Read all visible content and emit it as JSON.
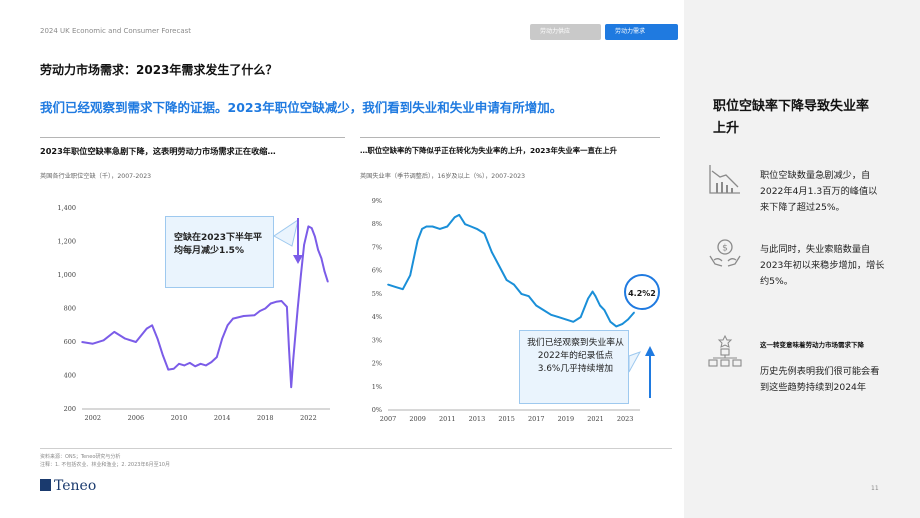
{
  "header": {
    "doc_title": "2024 UK Economic and Consumer Forecast",
    "tabs": [
      {
        "label": "劳动力供应",
        "active": false
      },
      {
        "label": "劳动力需求",
        "active": true
      }
    ]
  },
  "page": {
    "title": "劳动力市场需求：2023年需求发生了什么？",
    "subtitle": "我们已经观察到需求下降的证据。2023年职位空缺减少，我们看到失业和失业申请有所增加。"
  },
  "chart1": {
    "title": "2023年职位空缺率急剧下降，这表明劳动力市场需求正在收缩…",
    "subtitle": "英国各行业职位空缺（千），2007-2023",
    "callout": "空缺在2023下半年平均每月减少1.5%"
  },
  "chart2": {
    "title": "…职位空缺率的下降似乎正在转化为失业率的上升，2023年失业率一直在上升",
    "subtitle": "英国失业率（季节调整后），16岁及以上（%），2007-2023",
    "callout": "我们已经观察到失业率从2022年的纪录低点3.6%几乎持续增加",
    "bubble": "4.2%2"
  },
  "footer": {
    "source": "资料来源：ONS；Teneo研究与分析",
    "notes": "注释：1. 不包括农业、林业和渔业；2. 2023年6月至10月",
    "logo": "Teneo",
    "page_number": "11"
  },
  "sidebar": {
    "title": "职位空缺率下降导致失业率上升",
    "items": [
      {
        "icon": "declining-chart-icon",
        "text": "职位空缺数量急剧减少，自2022年4月1.3百万的峰值以来下降了超过25%。"
      },
      {
        "icon": "hands-money-icon",
        "text": "与此同时，失业索赔数量自2023年初以来稳步增加，增长约5%。"
      },
      {
        "icon": "org-chart-icon",
        "heading": "这一转变意味着劳动力市场需求下降",
        "text": "历史先例表明我们很可能会看到这些趋势持续到2024年"
      }
    ]
  },
  "colors": {
    "accent": "#1f7ae0",
    "line1": "#7b5ce8",
    "line2": "#1a8fd8",
    "sidebar_bg": "#f2f2f2"
  },
  "chart_data": [
    {
      "type": "line",
      "title": "2023年职位空缺率急剧下降，这表明劳动力市场需求正在收缩…",
      "ylim": [
        200,
        1400
      ],
      "yticks": [
        "200",
        "400",
        "600",
        "800",
        "1,000",
        "1,200",
        "1,400"
      ],
      "xticks": [
        "2002",
        "2006",
        "2010",
        "2014",
        "2018",
        "2022"
      ],
      "x": [
        2001.0,
        2002.0,
        2003.0,
        2004.0,
        2005.0,
        2006.0,
        2007.0,
        2007.5,
        2008.0,
        2008.5,
        2009.0,
        2009.5,
        2010.0,
        2010.5,
        2011.0,
        2011.5,
        2012.0,
        2012.5,
        2013.0,
        2013.5,
        2014.0,
        2014.5,
        2015.0,
        2016.0,
        2017.0,
        2017.5,
        2018.0,
        2018.5,
        2019.0,
        2019.5,
        2020.0,
        2020.2,
        2020.4,
        2020.6,
        2020.8,
        2021.0,
        2021.3,
        2021.6,
        2022.0,
        2022.3,
        2022.6,
        2022.9,
        2023.2,
        2023.5,
        2023.8
      ],
      "series": [
        {
          "values": [
            600,
            590,
            610,
            660,
            620,
            600,
            680,
            700,
            620,
            520,
            435,
            440,
            470,
            460,
            475,
            455,
            470,
            460,
            480,
            510,
            620,
            700,
            740,
            755,
            760,
            785,
            800,
            830,
            840,
            845,
            810,
            560,
            330,
            500,
            650,
            800,
            1000,
            1180,
            1290,
            1280,
            1230,
            1150,
            1100,
            1020,
            960
          ]
        }
      ]
    },
    {
      "type": "line",
      "title": "…职位空缺率的下降似乎正在转化为失业率的上升，2023年失业率一直在上升",
      "ylim": [
        0,
        9
      ],
      "yticks": [
        "0%",
        "1%",
        "2%",
        "3%",
        "4%",
        "5%",
        "6%",
        "7%",
        "8%",
        "9%"
      ],
      "xticks": [
        "2007",
        "2009",
        "2011",
        "2013",
        "2015",
        "2017",
        "2019",
        "2021",
        "2023"
      ],
      "x": [
        2007.0,
        2007.5,
        2008.0,
        2008.5,
        2009.0,
        2009.3,
        2009.6,
        2010.0,
        2010.5,
        2011.0,
        2011.5,
        2011.8,
        2012.2,
        2012.6,
        2013.0,
        2013.5,
        2014.0,
        2014.5,
        2015.0,
        2015.5,
        2016.0,
        2016.5,
        2017.0,
        2017.5,
        2018.0,
        2018.5,
        2019.0,
        2019.5,
        2020.0,
        2020.5,
        2020.8,
        2021.0,
        2021.3,
        2021.6,
        2022.0,
        2022.4,
        2022.8,
        2023.2,
        2023.6
      ],
      "series": [
        {
          "values": [
            5.4,
            5.3,
            5.2,
            5.8,
            7.3,
            7.8,
            7.9,
            7.9,
            7.8,
            7.9,
            8.3,
            8.4,
            8.0,
            7.9,
            7.8,
            7.6,
            6.8,
            6.2,
            5.6,
            5.4,
            5.0,
            4.9,
            4.5,
            4.3,
            4.1,
            4.0,
            3.9,
            3.8,
            4.0,
            4.8,
            5.1,
            4.9,
            4.5,
            4.3,
            3.8,
            3.6,
            3.7,
            3.9,
            4.2
          ]
        }
      ]
    }
  ]
}
